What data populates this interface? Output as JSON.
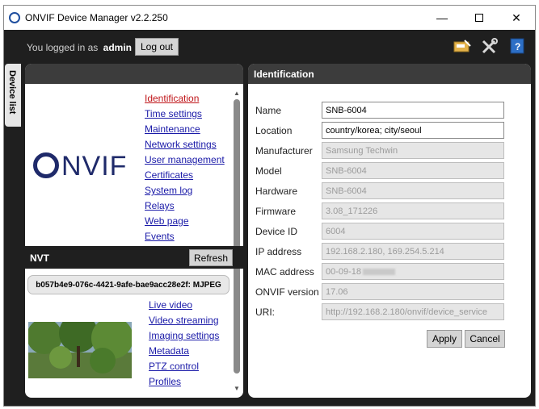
{
  "window": {
    "title": "ONVIF Device Manager v2.2.250"
  },
  "topbar": {
    "logged_prefix": "You logged in as",
    "user": "admin",
    "logout_label": "Log out"
  },
  "device_tab": {
    "label": "Device list"
  },
  "device_menu": {
    "logo_text": "NVIF",
    "items": [
      {
        "label": "Identification",
        "active": true
      },
      {
        "label": "Time settings"
      },
      {
        "label": "Maintenance"
      },
      {
        "label": "Network settings"
      },
      {
        "label": "User management"
      },
      {
        "label": "Certificates"
      },
      {
        "label": "System log"
      },
      {
        "label": "Relays"
      },
      {
        "label": "Web page"
      },
      {
        "label": "Events"
      }
    ]
  },
  "nvt": {
    "label": "NVT",
    "refresh_label": "Refresh",
    "stream": "b057b4e9-076c-4421-9afe-bae9acc28e2f: MJPEG"
  },
  "channel_menu": {
    "items": [
      {
        "label": "Live video"
      },
      {
        "label": "Video streaming"
      },
      {
        "label": "Imaging settings"
      },
      {
        "label": "Metadata"
      },
      {
        "label": "PTZ control"
      },
      {
        "label": "Profiles"
      }
    ]
  },
  "identification": {
    "header": "Identification",
    "fields": [
      {
        "label": "Name",
        "value": "SNB-6004",
        "readonly": false
      },
      {
        "label": "Location",
        "value": "country/korea; city/seoul",
        "readonly": false
      },
      {
        "label": "Manufacturer",
        "value": "Samsung Techwin",
        "readonly": true
      },
      {
        "label": "Model",
        "value": "SNB-6004",
        "readonly": true
      },
      {
        "label": "Hardware",
        "value": "SNB-6004",
        "readonly": true
      },
      {
        "label": "Firmware",
        "value": "3.08_171226",
        "readonly": true
      },
      {
        "label": "Device ID",
        "value": "6004",
        "readonly": true
      },
      {
        "label": "IP address",
        "value": "192.168.2.180, 169.254.5.214",
        "readonly": true
      },
      {
        "label": "MAC address",
        "value": "00-09-18",
        "readonly": true
      },
      {
        "label": "ONVIF version",
        "value": "17.06",
        "readonly": true
      },
      {
        "label": "URI:",
        "value": "http://192.168.2.180/onvif/device_service",
        "readonly": true
      }
    ],
    "apply_label": "Apply",
    "cancel_label": "Cancel"
  },
  "icons": {
    "app": "onvif-circle-icon",
    "connect": "network-card-icon",
    "settings": "tools-icon",
    "help": "help-book-icon"
  },
  "colors": {
    "link": "#1a1aa8",
    "active_link": "#c0161a",
    "panel_header": "#3c3c3c",
    "background": "#1f1f1f"
  }
}
